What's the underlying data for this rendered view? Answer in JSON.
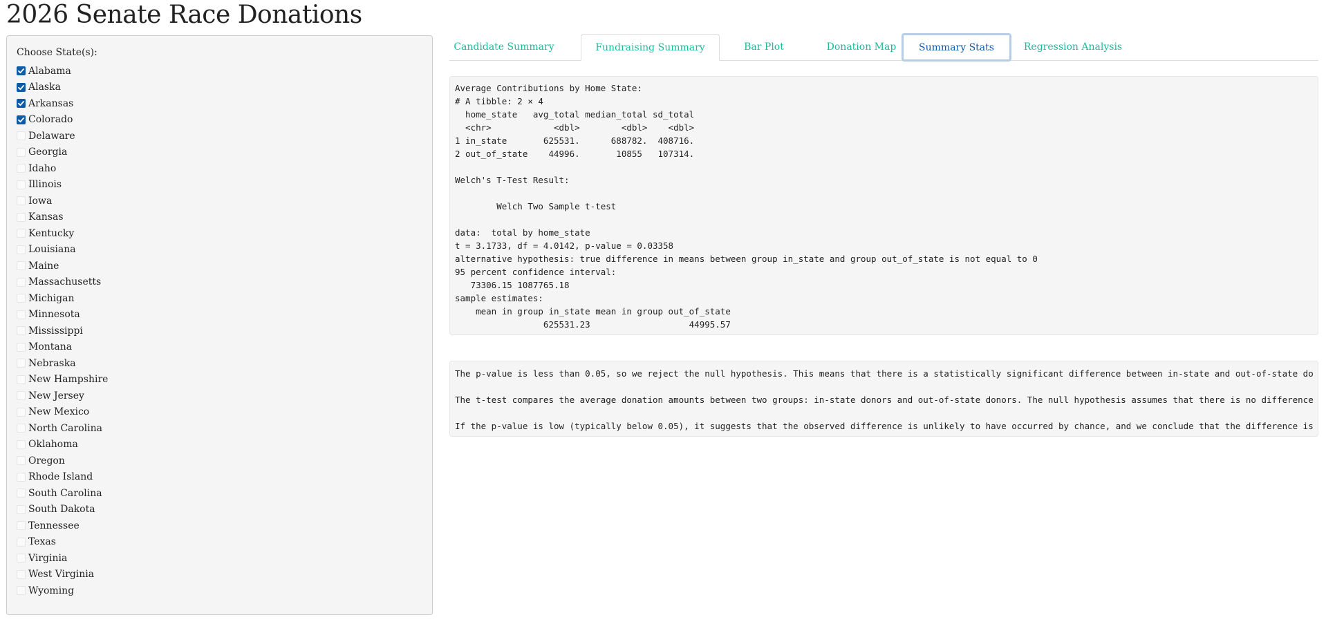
{
  "app": {
    "title": "2026 Senate Race Donations"
  },
  "sidebar": {
    "label": "Choose State(s):",
    "states": [
      {
        "name": "Alabama",
        "checked": true
      },
      {
        "name": "Alaska",
        "checked": true
      },
      {
        "name": "Arkansas",
        "checked": true
      },
      {
        "name": "Colorado",
        "checked": true
      },
      {
        "name": "Delaware",
        "checked": false
      },
      {
        "name": "Georgia",
        "checked": false
      },
      {
        "name": "Idaho",
        "checked": false
      },
      {
        "name": "Illinois",
        "checked": false
      },
      {
        "name": "Iowa",
        "checked": false
      },
      {
        "name": "Kansas",
        "checked": false
      },
      {
        "name": "Kentucky",
        "checked": false
      },
      {
        "name": "Louisiana",
        "checked": false
      },
      {
        "name": "Maine",
        "checked": false
      },
      {
        "name": "Massachusetts",
        "checked": false
      },
      {
        "name": "Michigan",
        "checked": false
      },
      {
        "name": "Minnesota",
        "checked": false
      },
      {
        "name": "Mississippi",
        "checked": false
      },
      {
        "name": "Montana",
        "checked": false
      },
      {
        "name": "Nebraska",
        "checked": false
      },
      {
        "name": "New Hampshire",
        "checked": false
      },
      {
        "name": "New Jersey",
        "checked": false
      },
      {
        "name": "New Mexico",
        "checked": false
      },
      {
        "name": "North Carolina",
        "checked": false
      },
      {
        "name": "Oklahoma",
        "checked": false
      },
      {
        "name": "Oregon",
        "checked": false
      },
      {
        "name": "Rhode Island",
        "checked": false
      },
      {
        "name": "South Carolina",
        "checked": false
      },
      {
        "name": "South Dakota",
        "checked": false
      },
      {
        "name": "Tennessee",
        "checked": false
      },
      {
        "name": "Texas",
        "checked": false
      },
      {
        "name": "Virginia",
        "checked": false
      },
      {
        "name": "West Virginia",
        "checked": false
      },
      {
        "name": "Wyoming",
        "checked": false
      }
    ]
  },
  "tabs": [
    {
      "label": "Candidate Summary"
    },
    {
      "label": "Fundraising Summary"
    },
    {
      "label": "Bar Plot"
    },
    {
      "label": "Donation Map"
    },
    {
      "label": "Summary Stats",
      "active": true
    },
    {
      "label": "Regression Analysis"
    }
  ],
  "stats_output": "Average Contributions by Home State:\n# A tibble: 2 × 4\n  home_state   avg_total median_total sd_total\n  <chr>            <dbl>        <dbl>    <dbl>\n1 in_state       625531.      688782.  408716.\n2 out_of_state    44996.       10855   107314.\n\nWelch's T-Test Result:\n\n        Welch Two Sample t-test\n\ndata:  total by home_state\nt = 3.1733, df = 4.0142, p-value = 0.03358\nalternative hypothesis: true difference in means between group in_state and group out_of_state is not equal to 0\n95 percent confidence interval:\n   73306.15 1087765.18\nsample estimates:\n    mean in group in_state mean in group out_of_state \n                 625531.23                   44995.57 ",
  "interpretation_output": "The p-value is less than 0.05, so we reject the null hypothesis. This means that there is a statistically significant difference between in-state and out-of-state do\n\nThe t-test compares the average donation amounts between two groups: in-state donors and out-of-state donors. The null hypothesis assumes that there is no difference\n\nIf the p-value is low (typically below 0.05), it suggests that the observed difference is unlikely to have occurred by chance, and we conclude that the difference is",
  "colors": {
    "tab_link": "#18bc9c",
    "tab_active_text": "#0d5aa7",
    "checkbox_checked": "#0d5aa7",
    "panel_bg": "#f5f5f5"
  }
}
